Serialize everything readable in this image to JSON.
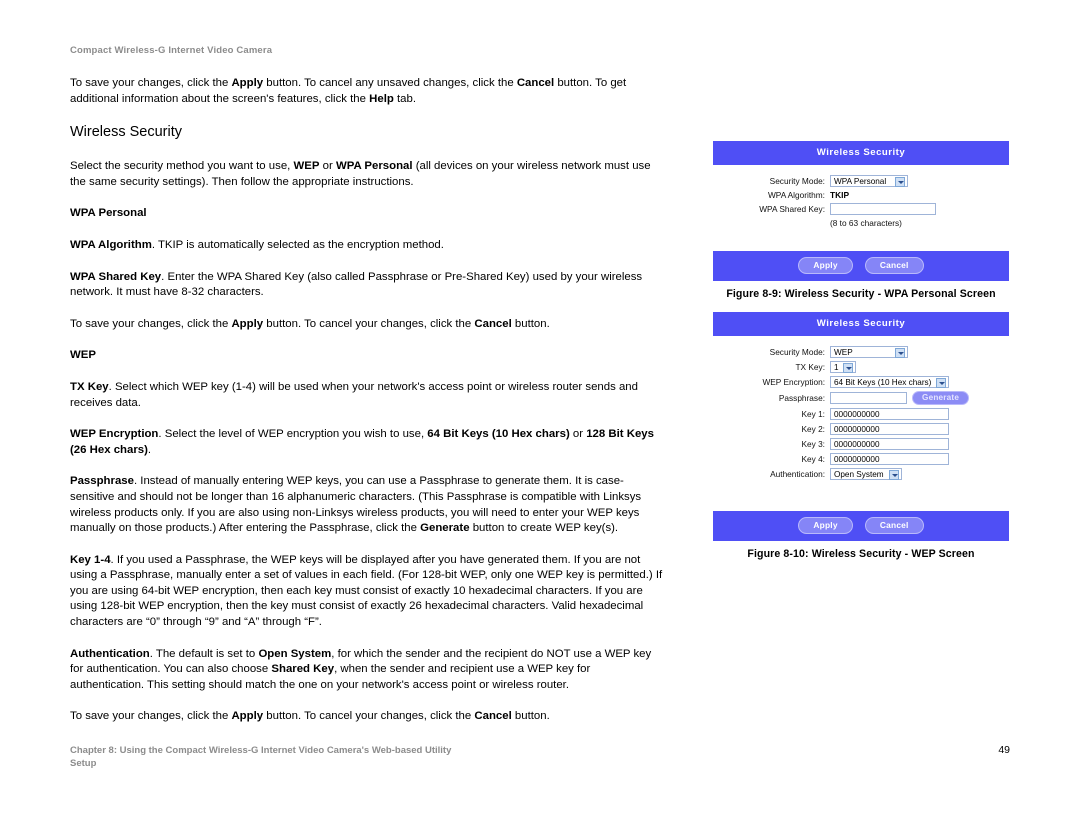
{
  "running_head": "Compact Wireless-G Internet Video Camera",
  "body": {
    "intro_para_html": "To save your changes, click the <b>Apply</b> button. To cancel any unsaved changes, click the <b>Cancel</b> button. To get additional information about the screen's features, click the <b>Help</b> tab.",
    "section_title": "Wireless Security",
    "select_method_html": "Select the security method you want to use, <b>WEP</b> or <b>WPA Personal</b> (all devices on your wireless network must use the same security settings). Then follow the appropriate instructions.",
    "wpa_personal_head": "WPA Personal",
    "wpa_algorithm_html": "<b>WPA Algorithm</b>. TKIP is automatically selected as the encryption method.",
    "wpa_shared_key_html": "<b>WPA Shared Key</b>. Enter the WPA Shared Key (also called Passphrase or Pre-Shared Key) used by your wireless network. It must have 8-32 characters.",
    "save_cancel_1_html": "To save your changes, click the <b>Apply</b> button. To cancel your changes, click the <b>Cancel</b> button.",
    "wep_head": "WEP",
    "tx_key_html": "<b>TX Key</b>. Select which WEP key (1-4) will be used when your network's access point or wireless router sends and receives data.",
    "wep_encryption_html": "<b>WEP Encryption</b>. Select the level of WEP encryption you wish to use, <b>64 Bit Keys (10 Hex chars)</b> or <b>128 Bit Keys (26 Hex chars)</b>.",
    "passphrase_html": "<b>Passphrase</b>. Instead of manually entering WEP keys, you can use a Passphrase to generate them. It is case-sensitive and should not be longer than 16 alphanumeric characters. (This Passphrase is compatible with Linksys wireless products only. If you are also using non-Linksys wireless products, you will need to enter your WEP keys manually on those products.) After entering the Passphrase, click the <b>Generate</b> button to create WEP key(s).",
    "key_1_4_html": "<b>Key 1-4</b>. If you used a Passphrase, the WEP keys will be displayed after you have generated them. If you are not using a Passphrase, manually enter a set of values in each field. (For 128-bit WEP, only one WEP key is permitted.) If you are using 64-bit WEP encryption, then each key must consist of exactly 10 hexadecimal characters. If you are using 128-bit WEP encryption, then the key must consist of exactly 26 hexadecimal characters. Valid hexadecimal characters are &ldquo;0&rdquo; through &ldquo;9&rdquo; and &ldquo;A&rdquo; through &ldquo;F&rdquo;.",
    "authentication_html": "<b>Authentication</b>. The default is set to <b>Open System</b>, for which the sender and the recipient do NOT use a WEP key for authentication. You can also choose <b>Shared Key</b>, when the sender and recipient use a WEP key for authentication. This setting should match the one on your network's access point or wireless router.",
    "save_cancel_2_html": "To save your changes, click the <b>Apply</b> button. To cancel your changes, click the <b>Cancel</b> button."
  },
  "figures": {
    "wpa": {
      "title": "Wireless Security",
      "caption": "Figure 8-9: Wireless Security - WPA Personal Screen",
      "fields": {
        "security_mode_label": "Security Mode:",
        "security_mode_value": "WPA Personal",
        "wpa_algorithm_label": "WPA Algorithm:",
        "wpa_algorithm_value": "TKIP",
        "wpa_shared_key_label": "WPA Shared Key:",
        "wpa_shared_key_value": "",
        "wpa_shared_key_hint": "(8 to 63 characters)"
      },
      "buttons": {
        "apply": "Apply",
        "cancel": "Cancel"
      }
    },
    "wep": {
      "title": "Wireless Security",
      "caption": "Figure 8-10: Wireless Security - WEP Screen",
      "fields": {
        "security_mode_label": "Security Mode:",
        "security_mode_value": "WEP",
        "tx_key_label": "TX Key:",
        "tx_key_value": "1",
        "wep_encryption_label": "WEP Encryption:",
        "wep_encryption_value": "64 Bit Keys (10 Hex chars)",
        "passphrase_label": "Passphrase:",
        "passphrase_value": "",
        "generate_label": "Generate",
        "key1_label": "Key 1:",
        "key1_value": "0000000000",
        "key2_label": "Key 2:",
        "key2_value": "0000000000",
        "key3_label": "Key 3:",
        "key3_value": "0000000000",
        "key4_label": "Key 4:",
        "key4_value": "0000000000",
        "authentication_label": "Authentication:",
        "authentication_value": "Open System"
      },
      "buttons": {
        "apply": "Apply",
        "cancel": "Cancel"
      }
    }
  },
  "footer": {
    "chapter_line_1": "Chapter 8: Using the Compact Wireless-G Internet Video Camera's Web-based Utility",
    "chapter_line_2": "Setup",
    "page_number": "49"
  },
  "colors": {
    "header_blue": "#4f4ff5",
    "button_blue": "#8585f7",
    "muted_gray": "#8c8c8c",
    "field_border": "#9fb4d8"
  }
}
